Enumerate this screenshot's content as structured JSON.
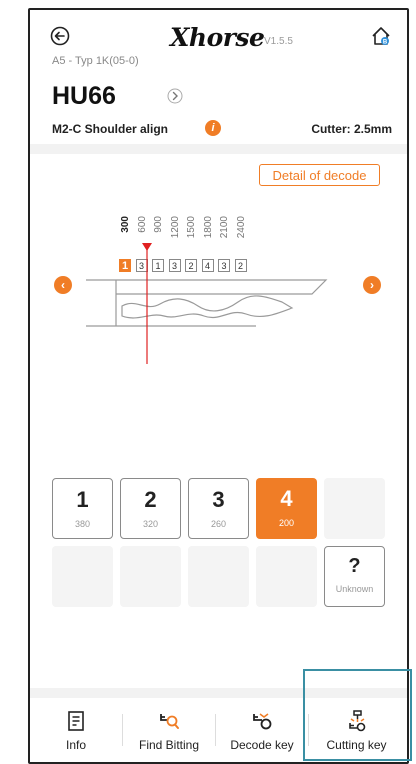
{
  "app": {
    "logo": "Xhorse",
    "version": "V1.5.5"
  },
  "key": {
    "subtitle": "A5 - Typ 1K(05-0)",
    "model": "HU66",
    "spec": "M2-C  Shoulder align",
    "cutter": "Cutter: 2.5mm"
  },
  "decode": {
    "detail_label": "Detail of decode",
    "depth_labels": [
      "300",
      "600",
      "900",
      "1200",
      "1500",
      "1800",
      "2100",
      "2400"
    ],
    "cuts": [
      "1",
      "3",
      "1",
      "3",
      "2",
      "4",
      "3",
      "2"
    ],
    "active_index": 0
  },
  "grid": {
    "options": [
      {
        "num": "1",
        "sub": "380"
      },
      {
        "num": "2",
        "sub": "320"
      },
      {
        "num": "3",
        "sub": "260"
      },
      {
        "num": "4",
        "sub": "200"
      }
    ],
    "unknown": {
      "num": "?",
      "sub": "Unknown"
    },
    "selected_index": 3
  },
  "nav": {
    "items": [
      {
        "label": "Info",
        "icon": "document-icon"
      },
      {
        "label": "Find Bitting",
        "icon": "key-search-icon"
      },
      {
        "label": "Decode key",
        "icon": "decode-key-icon"
      },
      {
        "label": "Cutting key",
        "icon": "cutter-icon"
      }
    ]
  },
  "colors": {
    "accent": "#f07d26",
    "highlight": "#3a8fa3"
  }
}
